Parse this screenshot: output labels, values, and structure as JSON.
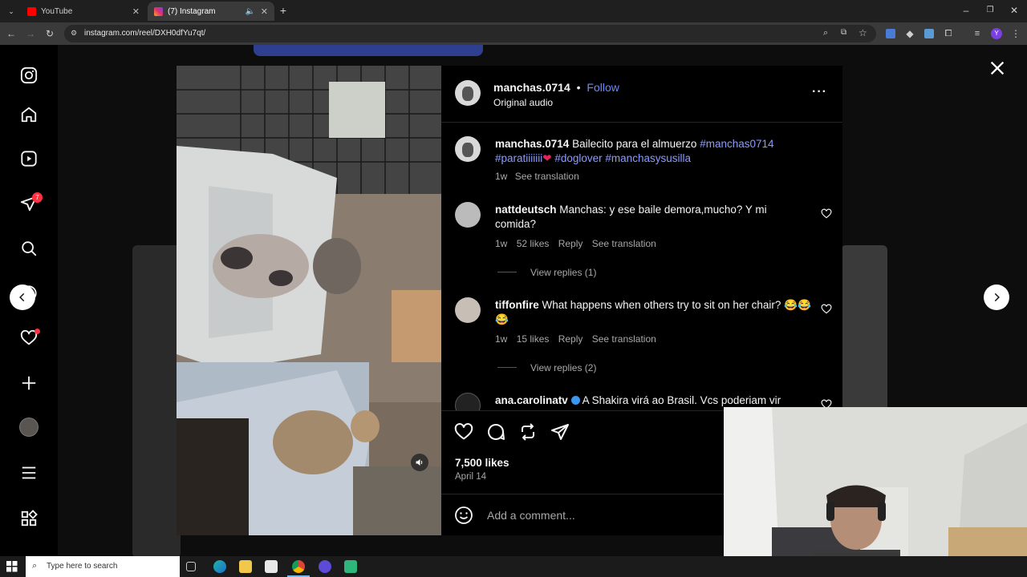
{
  "browser": {
    "tabs": [
      {
        "title": "YouTube",
        "active": false,
        "color": "#ff0000"
      },
      {
        "title": "(7) Instagram",
        "active": true,
        "color": "#e1306c"
      }
    ],
    "url": "instagram.com/reel/DXH0dfYu7qt/"
  },
  "sidebar": {
    "items": [
      "instagram-logo-icon",
      "home-icon",
      "reels-icon",
      "messages-icon",
      "search-icon",
      "explore-icon",
      "notifications-icon",
      "create-icon",
      "profile-icon",
      "more-icon",
      "apps-icon"
    ],
    "messages_badge": "7"
  },
  "post": {
    "author": "manchas.0714",
    "follow_label": "Follow",
    "audio": "Original audio",
    "caption_text": "Bailecito para el almuerzo",
    "caption_tag1": "#manchas0714",
    "caption_tag2": "#paratiiiiiii",
    "caption_tag3": "#doglover",
    "caption_tag4": "#manchasysusilla",
    "caption_time": "1w",
    "see_translation": "See translation",
    "likes": "7,500 likes",
    "date": "April 14",
    "comment_placeholder": "Add a comment..."
  },
  "comments": [
    {
      "user": "nattdeutsch",
      "text": "Manchas: y ese baile demora,mucho? Y mi comida?",
      "time": "1w",
      "likes": "52 likes",
      "reply": "Reply",
      "translate": "See translation",
      "view_replies": "View replies (1)"
    },
    {
      "user": "tiffonfire",
      "text": "What happens when others try to sit on her chair? 😂😂😂",
      "time": "1w",
      "likes": "15 likes",
      "reply": "Reply",
      "translate": "See translation",
      "view_replies": "View replies (2)"
    },
    {
      "user": "ana.carolinatv",
      "text": "A Shakira virá ao Brasil. Vcs poderiam vir"
    }
  ],
  "taskbar": {
    "search_placeholder": "Type here to search"
  },
  "colors": {
    "accent_link": "#6b8afd",
    "hashtag": "#8c9bff",
    "badge": "#ff3040"
  }
}
